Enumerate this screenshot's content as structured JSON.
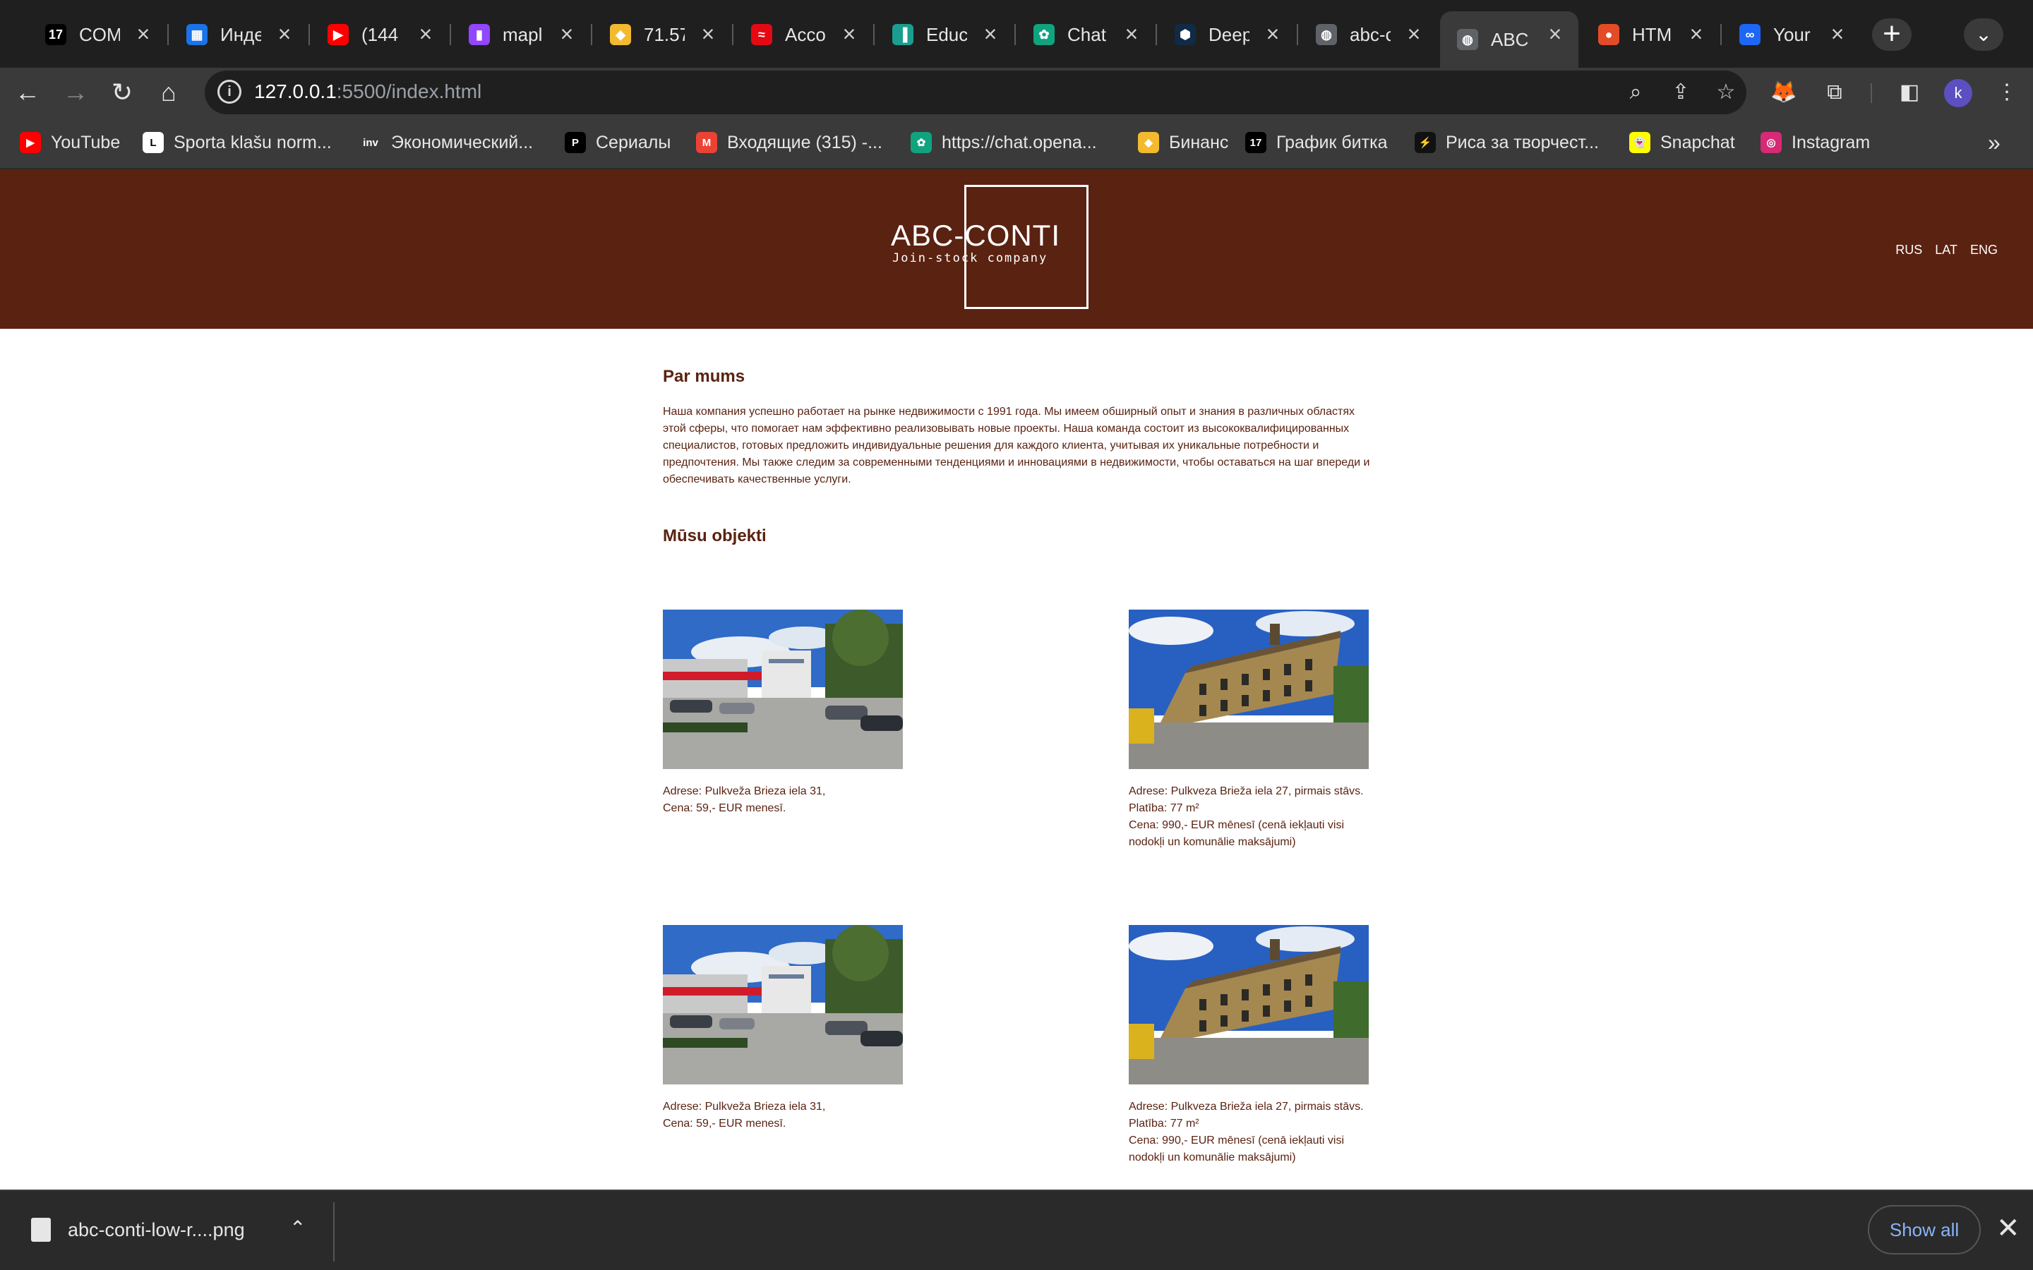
{
  "browser": {
    "tabs": [
      {
        "title": "COM",
        "icon": "tradingview-icon",
        "color": "#000000",
        "glyph": "17"
      },
      {
        "title": "Инде",
        "icon": "calendar-icon",
        "color": "#1a73e8",
        "glyph": "▦"
      },
      {
        "title": "(144",
        "icon": "youtube-icon",
        "color": "#ff0000",
        "glyph": "▶"
      },
      {
        "title": "mapl",
        "icon": "twitch-icon",
        "color": "#9146ff",
        "glyph": "▮"
      },
      {
        "title": "71.57",
        "icon": "binance-icon",
        "color": "#f3ba2f",
        "glyph": "◆"
      },
      {
        "title": "Acco",
        "icon": "account-icon",
        "color": "#e50914",
        "glyph": "≈"
      },
      {
        "title": "Educ",
        "icon": "education-icon",
        "color": "#1a9e8f",
        "glyph": "▐"
      },
      {
        "title": "Chat",
        "icon": "chatgpt-icon",
        "color": "#10a37f",
        "glyph": "✿"
      },
      {
        "title": "Deep",
        "icon": "deepl-icon",
        "color": "#0f2b46",
        "glyph": "⬢"
      },
      {
        "title": "abc-c",
        "icon": "globe-icon",
        "color": "#5f6368",
        "glyph": "◍"
      },
      {
        "title": "ABC",
        "icon": "globe-icon",
        "color": "#5f6368",
        "glyph": "◍",
        "active": true
      },
      {
        "title": "HTM",
        "icon": "html-icon",
        "color": "#e34c26",
        "glyph": "●"
      },
      {
        "title": "Your",
        "icon": "figma-icon",
        "color": "#1e66f5",
        "glyph": "∞"
      }
    ],
    "url_host": "127.0.0.1",
    "url_rest": ":5500/index.html",
    "avatar_letter": "k",
    "bookmarks": [
      {
        "label": "YouTube",
        "icon": "youtube-icon",
        "color": "#ff0000",
        "glyph": "▶"
      },
      {
        "label": "Sporta klašu norm...",
        "icon": "lpf-icon",
        "color": "#ffffff",
        "glyph": "L"
      },
      {
        "label": "Экономический...",
        "icon": "investing-icon",
        "color": "#3a3a3a",
        "glyph": "inv"
      },
      {
        "label": "Сериалы",
        "icon": "serials-icon",
        "color": "#000000",
        "glyph": "P"
      },
      {
        "label": "Входящие (315) -...",
        "icon": "gmail-icon",
        "color": "#ea4335",
        "glyph": "M"
      },
      {
        "label": "https://chat.opena...",
        "icon": "chatgpt-icon",
        "color": "#10a37f",
        "glyph": "✿"
      },
      {
        "label": "Бинанс",
        "icon": "binance-icon",
        "color": "#f3ba2f",
        "glyph": "◆"
      },
      {
        "label": "График битка",
        "icon": "tradingview-icon",
        "color": "#000000",
        "glyph": "17"
      },
      {
        "label": "Риса за творчест...",
        "icon": "art-icon",
        "color": "#111111",
        "glyph": "⚡"
      },
      {
        "label": "Snapchat",
        "icon": "snapchat-icon",
        "color": "#fffc00",
        "glyph": "👻"
      },
      {
        "label": "Instagram",
        "icon": "instagram-icon",
        "color": "#d62976",
        "glyph": "◎"
      }
    ]
  },
  "site": {
    "logo_title": "ABC-CONTI",
    "logo_subtitle": "Join-stock company",
    "languages": [
      "RUS",
      "LAT",
      "ENG"
    ],
    "about_heading": "Par mums",
    "about_text": "Наша компания успешно работает на рынке недвижимости с 1991 года. Мы имеем обширный опыт и знания в различных областях этой сферы, что помогает нам эффективно реализовывать новые проекты. Наша команда состоит из высококвалифицированных специалистов, готовых предложить индивидуальные решения для каждого клиента, учитывая их уникальные потребности и предпочтения. Мы также следим за современными тенденциями и инновациями в недвижимости, чтобы оставаться на шаг впереди и обеспечивать качественные услуги.",
    "objects_heading": "Mūsu objekti",
    "objects": [
      {
        "lines": [
          "Adrese: Pulkveža Brieza iela 31,",
          "Cena: 59,- EUR menesī."
        ],
        "photo": "parking"
      },
      {
        "lines": [
          "Adrese: Pulkveza Brieža iela 27, pirmais stāvs.",
          "Platība: 77 m²",
          "Cena: 990,- EUR mēnesī (cenā iekļauti visi",
          "nodokļi un komunālie maksājumi)"
        ],
        "photo": "building"
      },
      {
        "lines": [
          "Adrese: Pulkveža Brieza iela 31,",
          "Cena: 59,- EUR menesī."
        ],
        "photo": "parking"
      },
      {
        "lines": [
          "Adrese: Pulkveza Brieža iela 27, pirmais stāvs.",
          "Platība: 77 m²",
          "Cena: 990,- EUR mēnesī (cenā iekļauti visi",
          "nodokļi un komunālie maksājumi)"
        ],
        "photo": "building"
      }
    ]
  },
  "downloads": {
    "filename": "abc-conti-low-r....png",
    "show_all": "Show all"
  }
}
